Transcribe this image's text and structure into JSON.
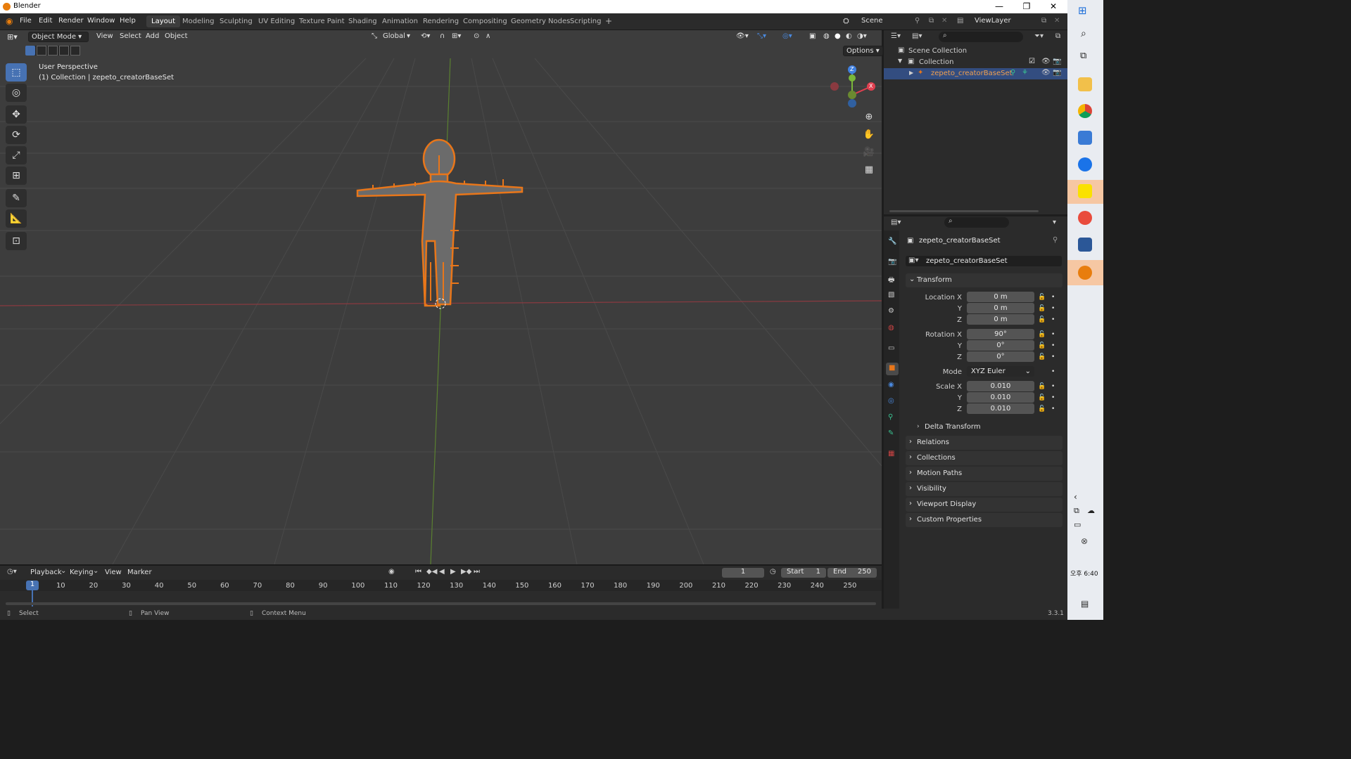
{
  "window": {
    "title": "Blender",
    "controls": [
      "—",
      "❐",
      "✕"
    ]
  },
  "menus": [
    "File",
    "Edit",
    "Render",
    "Window",
    "Help"
  ],
  "workspaces": [
    "Layout",
    "Modeling",
    "Sculpting",
    "UV Editing",
    "Texture Paint",
    "Shading",
    "Animation",
    "Rendering",
    "Compositing",
    "Geometry Nodes",
    "Scripting",
    "+"
  ],
  "scene": {
    "name": "Scene",
    "view_layer": "ViewLayer"
  },
  "viewport": {
    "mode": "Object Mode",
    "menu_view": "View",
    "menu_select": "Select",
    "menu_add": "Add",
    "menu_object": "Object",
    "orientation": "Global",
    "options": "Options",
    "overlay_title": "User Perspective",
    "overlay_sub": "(1) Collection | zepeto_creatorBaseSet",
    "gizmo": {
      "z": "Z",
      "y": "Y",
      "x": "X"
    }
  },
  "outliner": {
    "search": "",
    "items": [
      {
        "label": "Scene Collection"
      },
      {
        "label": "Collection"
      },
      {
        "label": "zepeto_creatorBaseSet"
      }
    ]
  },
  "properties": {
    "object_name": "zepeto_creatorBaseSet",
    "data_name": "zepeto_creatorBaseSet",
    "transform_title": "Transform",
    "location_label": "Location X",
    "loc_x": "0 m",
    "loc_y": "0 m",
    "loc_z": "0 m",
    "rotation_label": "Rotation X",
    "rot_x": "90°",
    "rot_y": "0°",
    "rot_z": "0°",
    "mode_label": "Mode",
    "mode_value": "XYZ Euler",
    "scale_label": "Scale X",
    "scale_x": "0.010",
    "scale_y": "0.010",
    "scale_z": "0.010",
    "y_label": "Y",
    "z_label": "Z",
    "sections": [
      "Delta Transform",
      "Relations",
      "Collections",
      "Motion Paths",
      "Visibility",
      "Viewport Display",
      "Custom Properties"
    ]
  },
  "timeline": {
    "menus": [
      "Playback",
      "Keying",
      "View",
      "Marker"
    ],
    "current_frame": "1",
    "start_label": "Start",
    "start": "1",
    "end_label": "End",
    "end": "250",
    "ticks": [
      "1",
      "10",
      "20",
      "30",
      "40",
      "50",
      "60",
      "70",
      "80",
      "90",
      "100",
      "110",
      "120",
      "130",
      "140",
      "150",
      "160",
      "170",
      "180",
      "190",
      "200",
      "210",
      "220",
      "230",
      "240",
      "250"
    ]
  },
  "statusbar": {
    "select": "Select",
    "pan": "Pan View",
    "context": "Context Menu",
    "version": "3.3.1"
  },
  "taskbar": {
    "time": "오후 6:40"
  },
  "colors": {
    "accent": "#4772b3",
    "selected_outline": "#e8761a",
    "x_axis": "#e04050",
    "y_axis": "#7ab73a",
    "z_axis": "#4080e0"
  }
}
